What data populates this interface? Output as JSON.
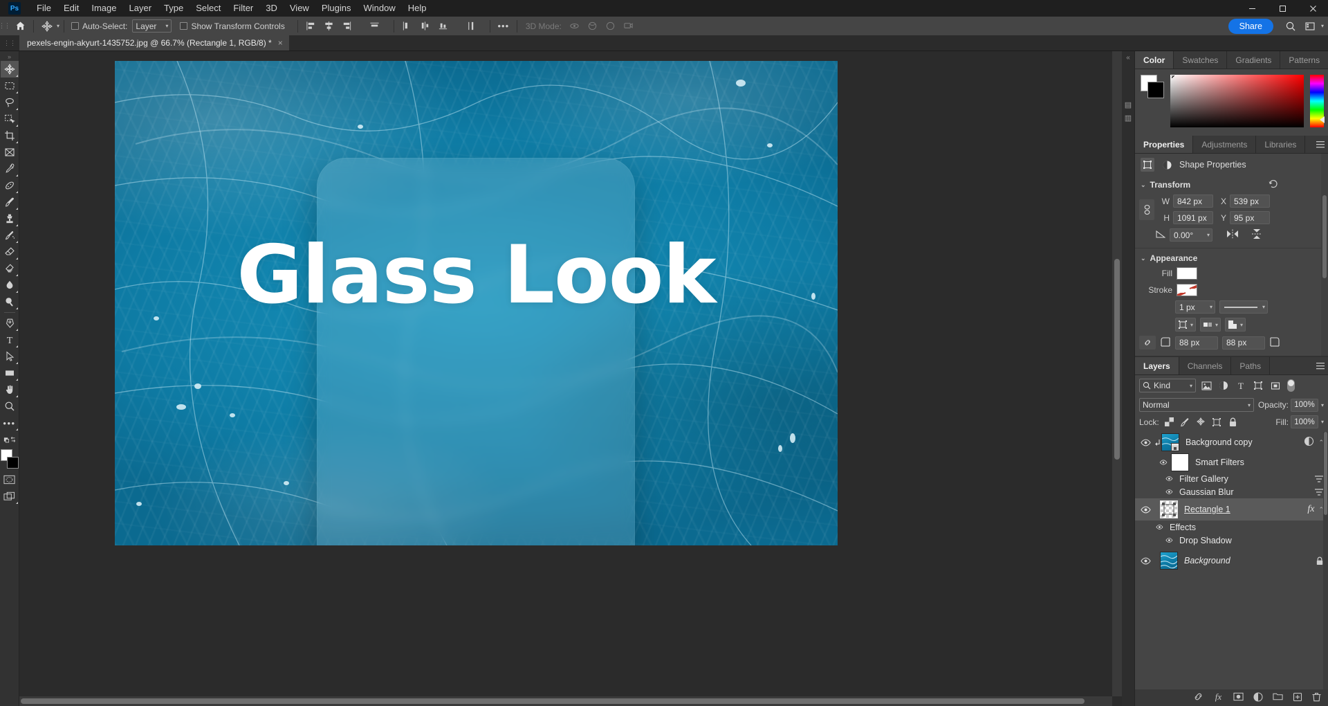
{
  "app": {
    "logo": "Ps",
    "name": "Adobe Photoshop"
  },
  "menubar": {
    "items": [
      "File",
      "Edit",
      "Image",
      "Layer",
      "Type",
      "Select",
      "Filter",
      "3D",
      "View",
      "Plugins",
      "Window",
      "Help"
    ],
    "window_controls": [
      "minimize",
      "maximize",
      "close"
    ]
  },
  "options_bar": {
    "home_icon": "home-icon",
    "tool_icon": "move-tool-icon",
    "auto_select_label": "Auto-Select:",
    "auto_select_checked": false,
    "auto_select_target": "Layer",
    "show_transform_label": "Show Transform Controls",
    "show_transform_checked": false,
    "align_icons": [
      "align-left-edges",
      "align-horizontal-centers",
      "align-right-edges",
      "align-top-edges"
    ],
    "distribute_icons": [
      "distribute-top-edges",
      "distribute-vertical-centers",
      "distribute-bottom-edges",
      "distribute-horizontal-centers"
    ],
    "more_label": "•••",
    "mode_3d_label": "3D Mode:",
    "share_label": "Share",
    "search_icon": "search-icon",
    "workspace_icon": "workspace-icon"
  },
  "document_tab": {
    "title": "pexels-engin-akyurt-1435752.jpg @ 66.7% (Rectangle 1, RGB/8) *",
    "close_label": "×"
  },
  "toolbar": {
    "tools": [
      {
        "name": "move-tool",
        "active": true
      },
      {
        "name": "rectangular-marquee-tool",
        "active": false
      },
      {
        "name": "lasso-tool",
        "active": false
      },
      {
        "name": "object-selection-tool",
        "active": false
      },
      {
        "name": "crop-tool",
        "active": false
      },
      {
        "name": "frame-tool",
        "active": false
      },
      {
        "name": "eyedropper-tool",
        "active": false
      },
      {
        "name": "spot-healing-brush-tool",
        "active": false
      },
      {
        "name": "brush-tool",
        "active": false
      },
      {
        "name": "clone-stamp-tool",
        "active": false
      },
      {
        "name": "history-brush-tool",
        "active": false
      },
      {
        "name": "eraser-tool",
        "active": false
      },
      {
        "name": "gradient-tool",
        "active": false
      },
      {
        "name": "blur-tool",
        "active": false
      },
      {
        "name": "dodge-tool",
        "active": false
      },
      {
        "name": "pen-tool",
        "active": false
      },
      {
        "name": "type-tool",
        "active": false
      },
      {
        "name": "path-selection-tool",
        "active": false
      },
      {
        "name": "rectangle-tool",
        "active": false
      },
      {
        "name": "hand-tool",
        "active": false
      },
      {
        "name": "zoom-tool",
        "active": false
      },
      {
        "name": "edit-toolbar",
        "active": false
      }
    ],
    "quick_mask_name": "quick-mask-mode",
    "screen_mode_name": "screen-mode"
  },
  "canvas": {
    "zoom": "66.7%",
    "artwork_text": "Glass Look",
    "background_description": "turquoise water surface photo"
  },
  "color_panel": {
    "tabs": [
      "Color",
      "Swatches",
      "Gradients",
      "Patterns"
    ],
    "active_tab": "Color",
    "foreground": "#ffffff",
    "background": "#000000",
    "menu_icon": "panel-menu-icon"
  },
  "properties_panel": {
    "tabs": [
      "Properties",
      "Adjustments",
      "Libraries"
    ],
    "active_tab": "Properties",
    "header_label": "Shape Properties",
    "transform": {
      "title": "Transform",
      "reset_icon": "reset-icon",
      "link_icon": "link-aspect-icon",
      "w_label": "W",
      "w_value": "842 px",
      "x_label": "X",
      "x_value": "539 px",
      "h_label": "H",
      "h_value": "1091 px",
      "y_label": "Y",
      "y_value": "95 px",
      "angle_icon": "angle-icon",
      "angle_value": "0.00°",
      "flip_h_icon": "flip-horizontal-icon",
      "flip_v_icon": "flip-vertical-icon"
    },
    "appearance": {
      "title": "Appearance",
      "fill_label": "Fill",
      "fill_color": "#ffffff",
      "stroke_label": "Stroke",
      "stroke_color": "none",
      "stroke_width": "1 px",
      "stroke_style": "solid-line",
      "align_icon": "stroke-align-icon",
      "caps_icon": "stroke-caps-icon",
      "corners_icon": "stroke-corners-icon",
      "radius_link_icon": "radius-link-icon",
      "corner_tl": "88 px",
      "corner_tr": "88 px"
    }
  },
  "layers_panel": {
    "tabs": [
      "Layers",
      "Channels",
      "Paths"
    ],
    "active_tab": "Layers",
    "filter_label": "Kind",
    "filter_icons": [
      "pixel-filter-icon",
      "adjustment-filter-icon",
      "type-filter-icon",
      "shape-filter-icon",
      "smart-object-filter-icon"
    ],
    "blend_mode": "Normal",
    "opacity_label": "Opacity:",
    "opacity_value": "100%",
    "lock_label": "Lock:",
    "lock_icons": [
      "lock-transparent-pixels",
      "lock-image-pixels",
      "lock-position",
      "lock-artboard-nesting",
      "lock-all"
    ],
    "fill_label": "Fill:",
    "fill_value": "100%",
    "layers": [
      {
        "name": "Background copy",
        "visible": true,
        "selected": false,
        "thumb": "water",
        "clipped": true,
        "smart_object": true,
        "right_icon": "smart-filter-icon",
        "expanded": true,
        "children": [
          {
            "name": "Smart Filters",
            "visible": true,
            "thumb": "white",
            "indent": 1
          },
          {
            "name": "Filter Gallery",
            "visible": true,
            "indent": 2,
            "right_icon": "filter-options-icon"
          },
          {
            "name": "Gaussian Blur",
            "visible": true,
            "indent": 2,
            "right_icon": "filter-options-icon"
          }
        ]
      },
      {
        "name": "Rectangle 1",
        "visible": true,
        "selected": true,
        "thumb": "checker",
        "shape": true,
        "right_icon": "fx",
        "expanded": true,
        "children": [
          {
            "name": "Effects",
            "visible": true,
            "indent": 1
          },
          {
            "name": "Drop Shadow",
            "visible": true,
            "indent": 2
          }
        ]
      },
      {
        "name": "Background",
        "visible": true,
        "selected": false,
        "thumb": "water",
        "italic": true,
        "locked": true,
        "right_icon": "lock-icon"
      }
    ],
    "bottom_icons": [
      "link-layers",
      "add-layer-style",
      "add-layer-mask",
      "new-fill-adjustment",
      "new-group",
      "new-layer",
      "delete-layer"
    ]
  }
}
